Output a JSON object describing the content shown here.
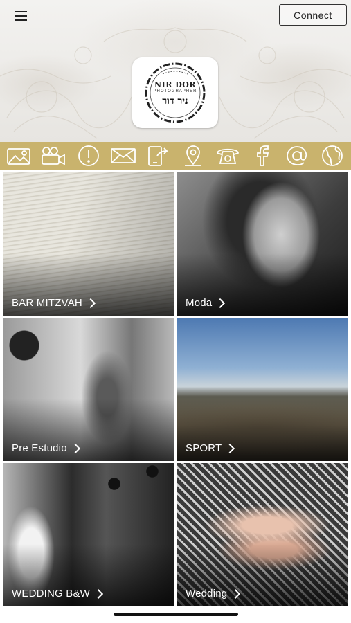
{
  "header": {
    "connect_label": "Connect",
    "logo": {
      "line1": "NIR DOR",
      "line2": "PHOTOGRAPHER",
      "line3": "ניר דור"
    }
  },
  "iconbar": [
    {
      "icon": "gallery-icon"
    },
    {
      "icon": "video-camera-icon"
    },
    {
      "icon": "info-icon"
    },
    {
      "icon": "mail-icon"
    },
    {
      "icon": "share-icon"
    },
    {
      "icon": "location-pin-icon"
    },
    {
      "icon": "phone-icon"
    },
    {
      "icon": "facebook-icon"
    },
    {
      "icon": "at-sign-icon"
    },
    {
      "icon": "globe-icon"
    }
  ],
  "tiles": [
    {
      "label": "BAR MITZVAH"
    },
    {
      "label": "Moda"
    },
    {
      "label": "Pre Estudio"
    },
    {
      "label": "SPORT"
    },
    {
      "label": "WEDDING B&W"
    },
    {
      "label": "Wedding"
    }
  ],
  "colors": {
    "iconbar_bg": "#c9b36d",
    "tile_label": "#ffffff"
  }
}
